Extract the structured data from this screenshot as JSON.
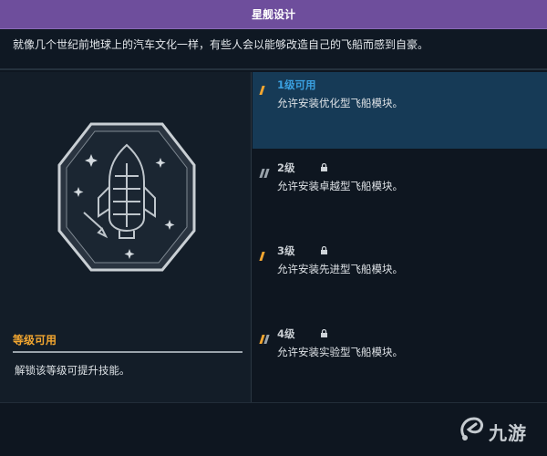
{
  "window": {
    "title": "星舰设计"
  },
  "description": "就像几个世纪前地球上的汽车文化一样，有些人会以能够改造自己的飞船而感到自豪。",
  "badge": {
    "icon": "rocket-pencil-icon"
  },
  "selected_panel": {
    "title": "等级可用",
    "subtitle": "解锁该等级可提升技能。"
  },
  "tiers": [
    {
      "name": "1级可用",
      "desc": "允许安装优化型飞船模块。",
      "locked": false,
      "selected": true,
      "color": "#3aa0e0"
    },
    {
      "name": "2级",
      "desc": "允许安装卓越型飞船模块。",
      "locked": true,
      "selected": false,
      "color": "#c8cdd2"
    },
    {
      "name": "3级",
      "desc": "允许安装先进型飞船模块。",
      "locked": true,
      "selected": false,
      "color": "#c8cdd2"
    },
    {
      "name": "4级",
      "desc": "允许安装实验型飞船模块。",
      "locked": true,
      "selected": false,
      "color": "#c8cdd2"
    }
  ],
  "watermark": {
    "text": "九游"
  },
  "colors": {
    "title_bar": "#6e4e9c",
    "accent_orange": "#f2a630",
    "accent_blue": "#3aa0e0",
    "selected_row": "#163a56"
  }
}
